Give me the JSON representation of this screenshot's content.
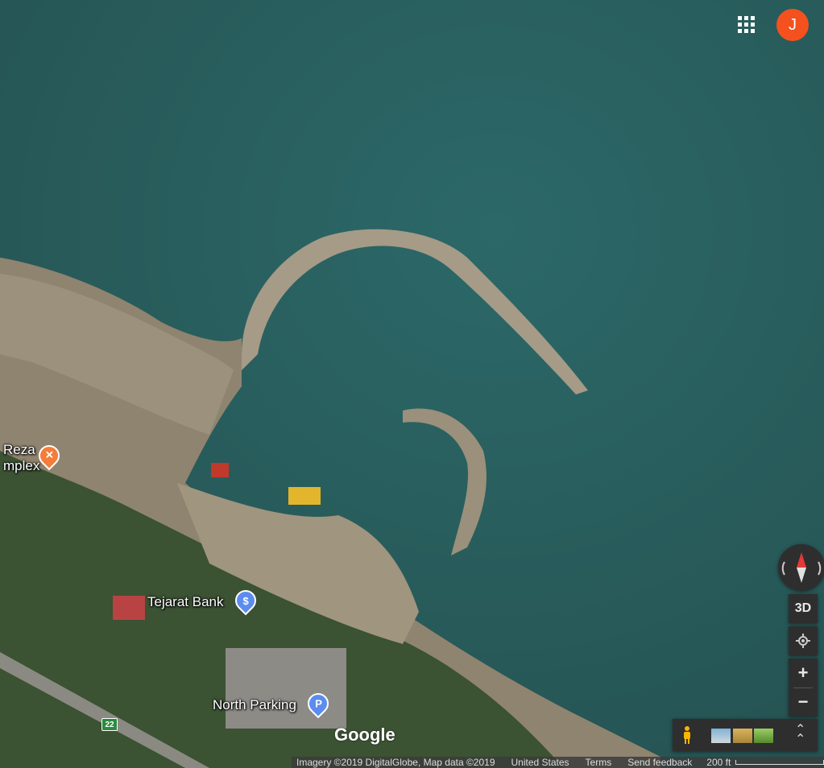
{
  "map": {
    "type": "satellite",
    "colors": {
      "water": "#2a5d5c",
      "land": "#6b6a55",
      "beach": "#9b8f7a",
      "jetty": "#a39a86",
      "trees": "#2f4a2a"
    }
  },
  "header": {
    "apps_icon": "apps-grid-icon",
    "avatar_letter": "J",
    "avatar_color": "#f4511e"
  },
  "places": [
    {
      "label": "Reza\nmplex",
      "line1": "Reza",
      "line2": "mplex",
      "icon": "restaurant-icon",
      "color": "#f57c3a"
    },
    {
      "label": "Tejarat Bank",
      "icon": "bank-icon",
      "color": "#5b8def"
    },
    {
      "label": "North Parking",
      "icon": "parking-icon",
      "color": "#5b8def",
      "glyph": "P"
    }
  ],
  "road_shield": "22",
  "controls": {
    "compass_icon": "compass-icon",
    "tilt_label": "3D",
    "location_icon": "my-location-icon",
    "zoom_in": "+",
    "zoom_out": "−",
    "pegman_icon": "pegman-icon",
    "expand_icon": "chevron-up-icon"
  },
  "footer": {
    "logo": "Google",
    "imagery": "Imagery ©2019 DigitalGlobe, Map data ©2019",
    "country": "United States",
    "terms": "Terms",
    "feedback": "Send feedback",
    "scale": "200 ft"
  }
}
